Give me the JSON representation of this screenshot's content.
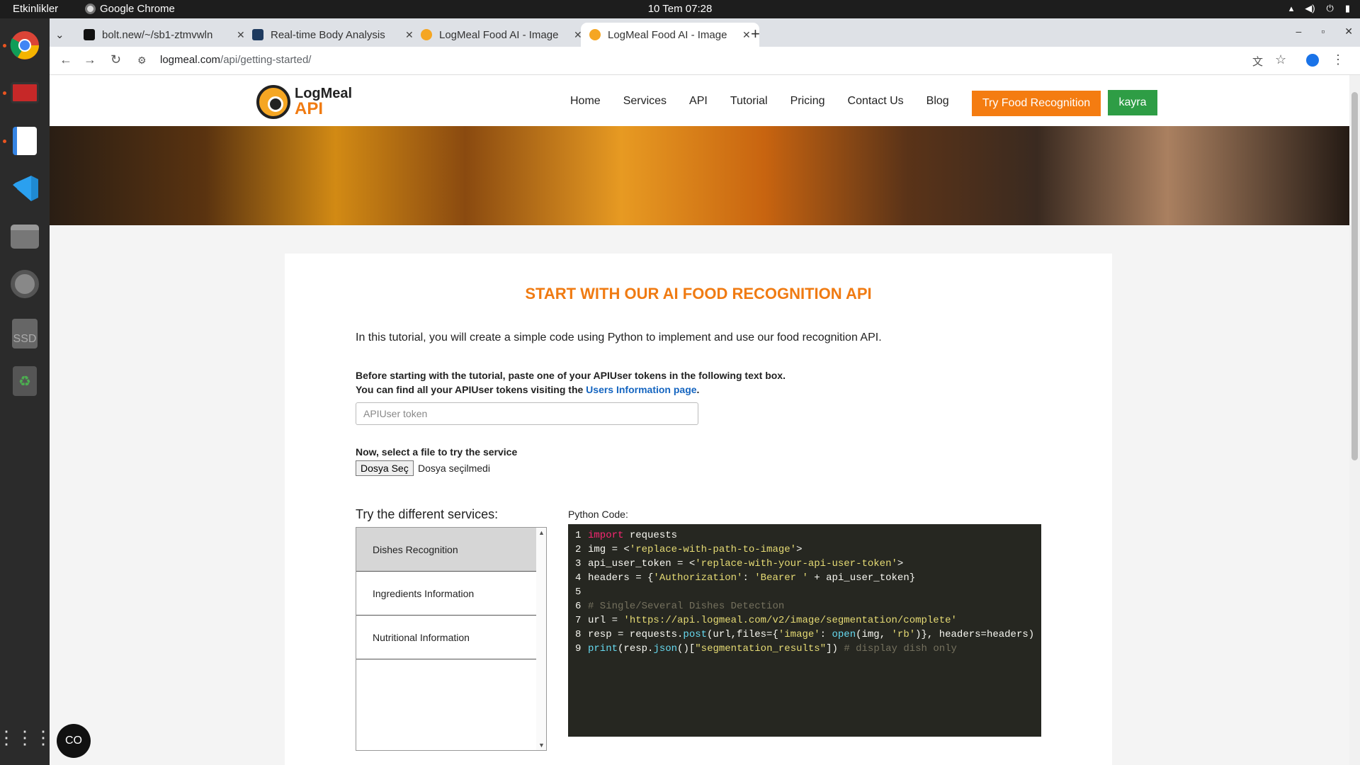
{
  "system": {
    "activities": "Etkinlikler",
    "app_name": "Google Chrome",
    "clock": "10 Tem  07:28",
    "tray_icons": [
      "wifi-icon",
      "volume-icon",
      "power-icon",
      "battery-icon"
    ]
  },
  "dock": {
    "items": [
      "chrome-icon",
      "screen-recorder-icon",
      "text-editor-icon",
      "vscode-icon",
      "files-icon",
      "settings-icon",
      "ssd-drive-icon",
      "trash-icon",
      "app-grid-icon"
    ],
    "ssd_label": "SSD"
  },
  "browser": {
    "tabs": [
      {
        "title": "bolt.new/~/sb1-ztmvwln",
        "favicon_color": "#111111"
      },
      {
        "title": "Real-time Body Analysis",
        "favicon_color": "#1e3a5f"
      },
      {
        "title": "LogMeal Food AI - Image",
        "favicon_color": "#f5a623"
      },
      {
        "title": "LogMeal Food AI - Image",
        "favicon_color": "#f5a623",
        "active": true
      }
    ],
    "url_host": "logmeal.com",
    "url_path": "/api/getting-started/"
  },
  "site": {
    "logo_line1": "LogMeal",
    "logo_line2": "API",
    "nav": [
      "Home",
      "Services",
      "API",
      "Tutorial",
      "Pricing",
      "Contact Us",
      "Blog"
    ],
    "cta_button": "Try Food Recognition",
    "user_button": "kayra",
    "accent": "#f47c11",
    "user_button_color": "#2e9d45"
  },
  "tutorial": {
    "title": "START WITH OUR AI FOOD RECOGNITION API",
    "intro": "In this tutorial, you will create a simple code using Python to implement and use our food recognition API.",
    "before_line1": "Before starting with the tutorial, paste one of your APIUser tokens in the following text box.",
    "before_line2_prefix": "You can find all your APIUser tokens visiting the ",
    "before_link": "Users Information page",
    "before_line2_suffix": ".",
    "token_placeholder": "APIUser token",
    "select_label": "Now, select a file to try the service",
    "file_button": "Dosya Seç",
    "file_status": "Dosya seçilmedi",
    "services_label": "Try the different services:",
    "services": [
      "Dishes Recognition",
      "Ingredients Information",
      "Nutritional Information"
    ],
    "code_label": "Python Code:"
  }
}
